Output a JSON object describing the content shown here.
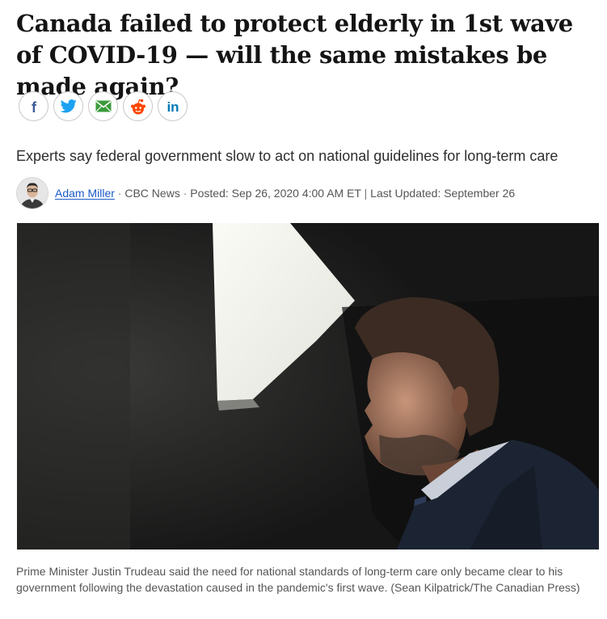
{
  "article": {
    "headline": "Canada failed to protect elderly in 1st wave of COVID-19 — will the same mistakes be made again?",
    "deck": "Experts say federal government slow to act on national guidelines for long-term care",
    "byline": {
      "author": "Adam Miller",
      "separator": "·",
      "outlet": "CBC News",
      "posted": "Posted: Sep 26, 2020 4:00 AM ET",
      "divider": "|",
      "updated": "Last Updated: September 26"
    },
    "image": {
      "caption": "Prime Minister Justin Trudeau said the need for national standards of long-term care only became clear to his government following the devastation caused in the pandemic's first wave. (Sean Kilpatrick/The Canadian Press)"
    }
  },
  "share": [
    {
      "icon": "facebook-icon",
      "color": "#3b5998"
    },
    {
      "icon": "twitter-icon",
      "color": "#1da1f2"
    },
    {
      "icon": "email-icon",
      "color": "#3a9b3a"
    },
    {
      "icon": "reddit-icon",
      "color": "#ff4500"
    },
    {
      "icon": "linkedin-icon",
      "color": "#0077b5"
    }
  ],
  "colors": {
    "headline": "#141414",
    "link": "#1a5ac9",
    "caption": "#555555"
  }
}
